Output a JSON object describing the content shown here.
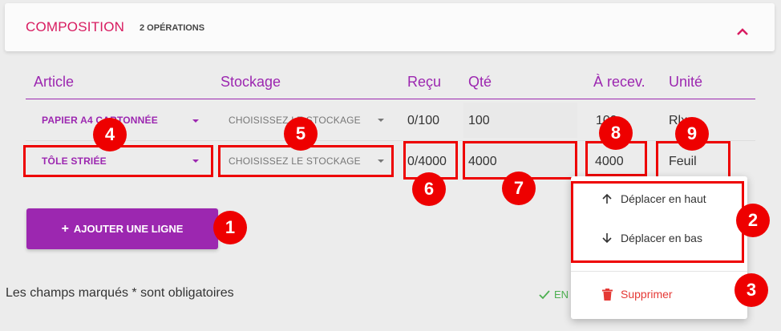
{
  "header": {
    "title": "Composition",
    "subtitle": "2 opérations"
  },
  "columns": {
    "article": "Article",
    "storage": "Stockage",
    "received": "Reçu",
    "qty": "Qté",
    "to_receive": "À recev.",
    "unit": "Unité"
  },
  "rows": [
    {
      "article": "PAPIER A4 CARTONNÉE",
      "storage": "CHOISISSEZ LE STOCKAGE",
      "received": "0/100",
      "qty": "100",
      "to_receive": "100",
      "unit": "Rlx"
    },
    {
      "article": "TÔLE STRIÉE",
      "storage": "CHOISISSEZ LE STOCKAGE",
      "received": "0/4000",
      "qty": "4000",
      "to_receive": "4000",
      "unit": "Feuil"
    }
  ],
  "actions": {
    "add_line": "AJOUTER UNE LIGNE",
    "required_note": "Les champs marqués * sont obligatoires",
    "saved": "EN"
  },
  "menu": {
    "move_up": "Déplacer en haut",
    "move_down": "Déplacer en bas",
    "delete": "Supprimer"
  },
  "badges": [
    "1",
    "2",
    "3",
    "4",
    "5",
    "6",
    "7",
    "8",
    "9"
  ],
  "colors": {
    "accent": "#9c27b0",
    "title": "#d81b60",
    "annotation": "#ee0000",
    "delete": "#e53935",
    "success": "#4caf50"
  }
}
